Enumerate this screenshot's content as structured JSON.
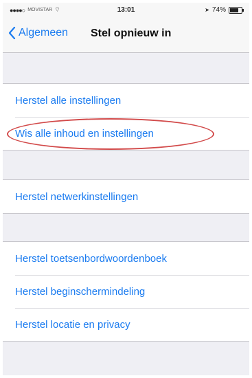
{
  "statusbar": {
    "carrier": "MOVISTAR",
    "time": "13:01",
    "battery": "74%",
    "battery_level": 0.74
  },
  "navbar": {
    "back_label": "Algemeen",
    "title": "Stel opnieuw in"
  },
  "groups": [
    {
      "items": [
        "Herstel alle instellingen",
        "Wis alle inhoud en instellingen"
      ]
    },
    {
      "items": [
        "Herstel netwerkinstellingen"
      ]
    },
    {
      "items": [
        "Herstel toetsenbordwoordenboek",
        "Herstel beginschermindeling",
        "Herstel locatie en privacy"
      ]
    }
  ],
  "colors": {
    "accent": "#1a7bf0",
    "highlight": "#d24a4a",
    "background": "#efeff4"
  }
}
